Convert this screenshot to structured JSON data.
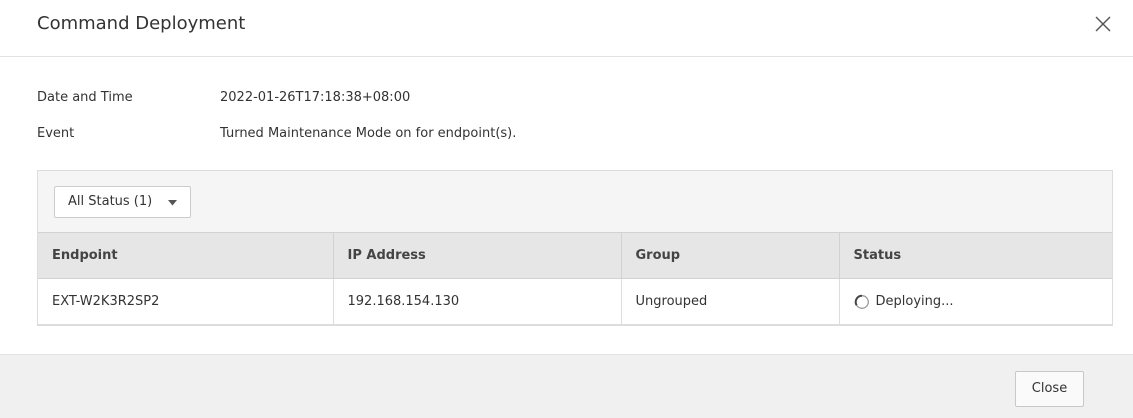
{
  "dialog": {
    "title": "Command Deployment",
    "close_icon": "close-x-icon"
  },
  "info": {
    "date_label": "Date and Time",
    "date_value": "2022-01-26T17:18:38+08:00",
    "event_label": "Event",
    "event_value": "Turned Maintenance Mode on for endpoint(s)."
  },
  "filter": {
    "selected": "All Status (1)",
    "caret_icon": "caret-down-icon"
  },
  "table": {
    "columns": [
      "Endpoint",
      "IP Address",
      "Group",
      "Status"
    ],
    "rows": [
      {
        "endpoint": "EXT-W2K3R2SP2",
        "ip": "192.168.154.130",
        "group": "Ungrouped",
        "status": "Deploying...",
        "status_icon": "loading-spinner-icon"
      }
    ]
  },
  "footer": {
    "close_label": "Close"
  }
}
